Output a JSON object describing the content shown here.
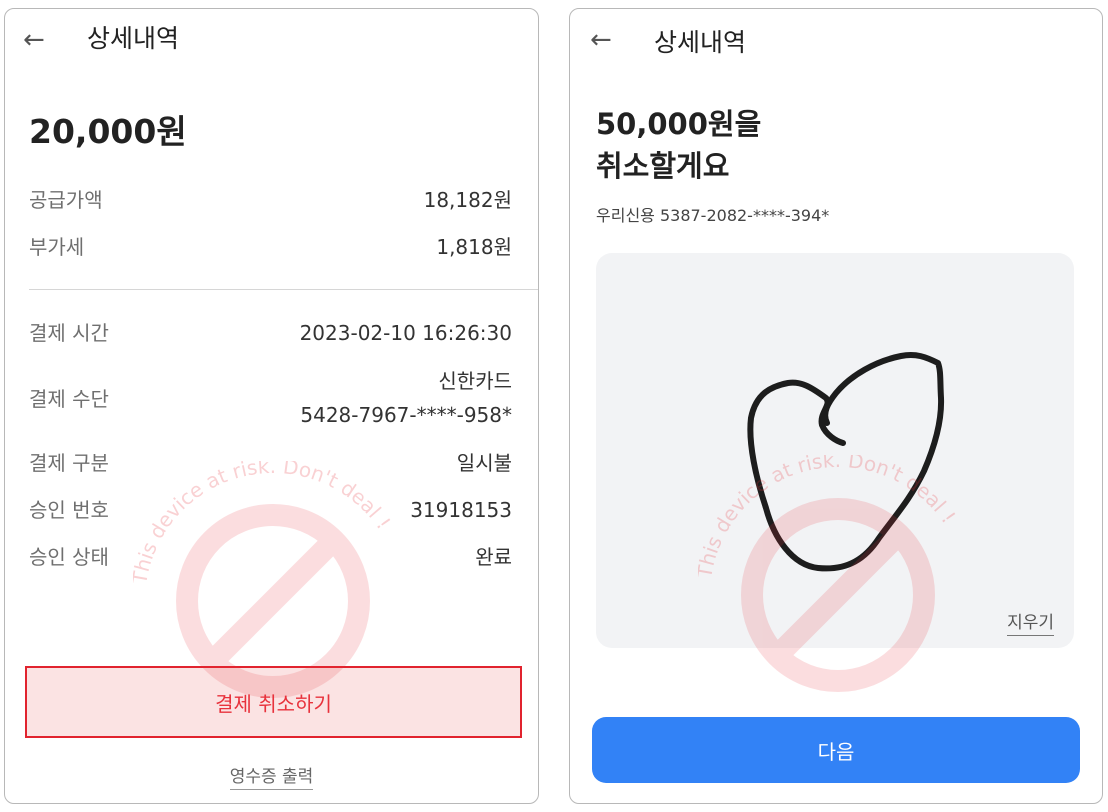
{
  "colors": {
    "accent": "#3282f6",
    "danger": "#e1232e",
    "watermark": "#e8343c"
  },
  "left": {
    "header": {
      "back_icon": "arrow-left-icon",
      "title": "상세내역"
    },
    "amount": "20,000원",
    "tax_rows": [
      {
        "label": "공급가액",
        "value": "18,182원"
      },
      {
        "label": "부가세",
        "value": "1,818원"
      }
    ],
    "details": [
      {
        "label": "결제 시간",
        "value": "2023-02-10 16:26:30"
      },
      {
        "label": "결제 수단",
        "value": "신한카드",
        "value2": "5428-7967-****-958*"
      },
      {
        "label": "결제 구분",
        "value": "일시불"
      },
      {
        "label": "승인 번호",
        "value": "31918153"
      },
      {
        "label": "승인 상태",
        "value": "완료"
      }
    ],
    "cancel_button": "결제 취소하기",
    "receipt_link": "영수증 출력"
  },
  "right": {
    "header": {
      "back_icon": "arrow-left-icon",
      "title": "상세내역"
    },
    "title_line1": "50,000원을",
    "title_line2": "취소할게요",
    "card": "우리신용 5387-2082-****-394*",
    "erase_link": "지우기",
    "next_button": "다음"
  },
  "watermark": {
    "text": "This device at risk. Don't deal !",
    "icon": "prohibition-icon"
  }
}
